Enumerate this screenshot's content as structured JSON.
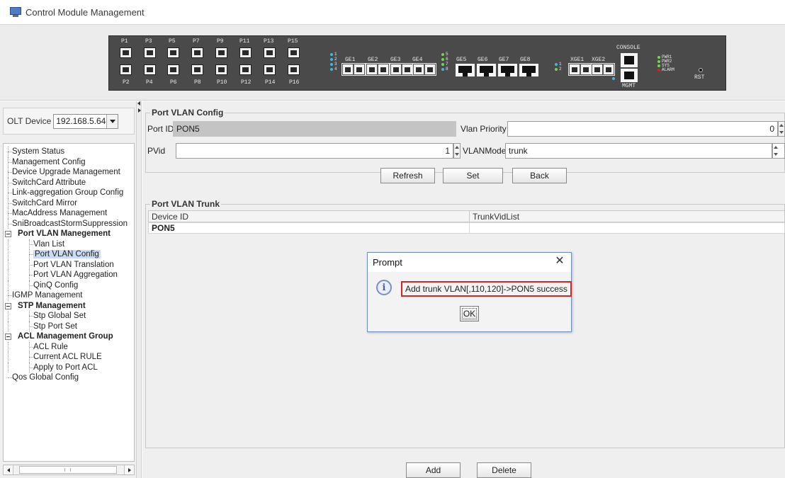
{
  "window": {
    "title": "Control Module Management",
    "icon": "monitor-icon"
  },
  "device_panel": {
    "pon_top_labels": [
      "P1",
      "P3",
      "P5",
      "P7",
      "P9",
      "P11",
      "P13",
      "P15"
    ],
    "pon_bottom_labels": [
      "P2",
      "P4",
      "P6",
      "P8",
      "P10",
      "P12",
      "P14",
      "P16"
    ],
    "ge_sfp_labels": [
      "GE1",
      "GE2",
      "GE3",
      "GE4"
    ],
    "ge_sfp_leds": [
      "1",
      "2",
      "3",
      "4"
    ],
    "ge_rj_labels": [
      "GE5",
      "GE6",
      "GE7",
      "GE8"
    ],
    "ge_rj_leds": [
      "5",
      "6",
      "7",
      "8"
    ],
    "xge_labels": [
      "XGE1",
      "XGE2"
    ],
    "xge_leds": [
      "1",
      "2"
    ],
    "console_label": "CONSOLE",
    "mgmt_label": "MGMT",
    "status_leds": [
      "PWR1",
      "PWR2",
      "SYS",
      "ALARM"
    ],
    "rst_label": "RST",
    "colors": {
      "panel": "#4a4a4a",
      "led_green": "#6fd84a",
      "led_blue": "#3fb6e6",
      "led_red": "#d82020"
    }
  },
  "sidebar": {
    "olt_label": "OLT Device",
    "olt_value": "192.168.5.64 ...",
    "items": [
      "System Status",
      "Management Config",
      "Device Upgrade Management",
      "SwitchCard Attribute",
      "Link-aggregation Group Config",
      "SwitchCard Mirror",
      "MacAddress Management",
      "SniBroadcastStormSuppression"
    ],
    "groups": {
      "port_vlan": {
        "label": "Port VLAN Manegement",
        "children": [
          "Vlan List",
          "Port VLAN Config",
          "Port VLAN Translation",
          "Port VLAN Aggregation",
          "QinQ Config"
        ]
      },
      "igmp": "IGMP Management",
      "stp": {
        "label": "STP Management",
        "children": [
          "Stp Global Set",
          "Stp Port Set"
        ]
      },
      "acl": {
        "label": "ACL Management Group",
        "children": [
          "ACL Rule",
          "Current ACL RULE",
          "Apply to Port ACL"
        ]
      },
      "qos": "Qos Global Config"
    },
    "selected": "Port VLAN Config"
  },
  "port_vlan_config": {
    "legend": "Port VLAN Config",
    "port_id_label": "Port ID",
    "port_id_value": "PON5",
    "vlan_priority_label": "Vlan Priority",
    "vlan_priority_value": "0",
    "pvid_label": "PVid",
    "pvid_value": "1",
    "vlanmode_label": "VLANMode",
    "vlanmode_value": "trunk",
    "buttons": {
      "refresh": "Refresh",
      "set": "Set",
      "back": "Back"
    }
  },
  "port_vlan_trunk": {
    "legend": "Port VLAN Trunk",
    "columns": [
      "Device ID",
      "TrunkVidList"
    ],
    "rows": [
      [
        "PON5",
        ""
      ]
    ],
    "buttons": {
      "add": "Add",
      "delete": "Delete"
    }
  },
  "prompt_dialog": {
    "title": "Prompt",
    "close": "✕",
    "message": "Add trunk VLAN[,110,120]->PON5 success",
    "ok": "OK",
    "highlight_color": "#d92323"
  }
}
